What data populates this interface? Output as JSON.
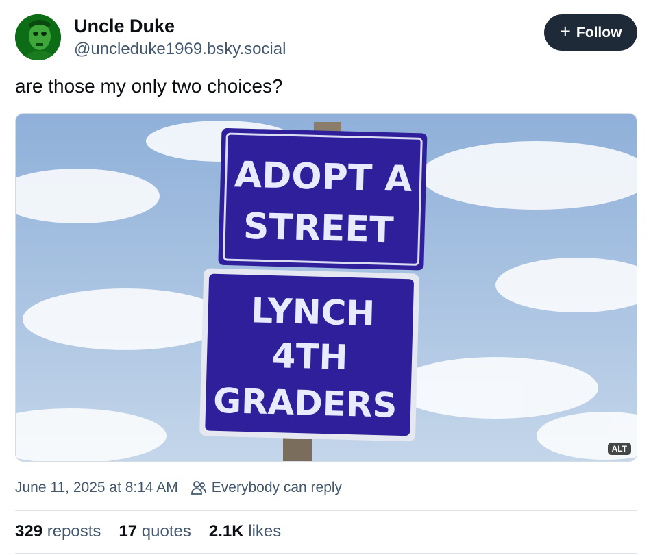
{
  "author": {
    "display_name": "Uncle Duke",
    "handle": "@uncleduke1969.bsky.social",
    "avatar_icon": "avatar-photo",
    "avatar_color": "#0d6d16"
  },
  "follow_button": {
    "label": "Follow",
    "icon": "plus-icon",
    "background": "#1e2a37"
  },
  "post": {
    "text": "are those my only two choices?",
    "image": {
      "sign_top_lines": [
        "ADOPT A",
        "STREET"
      ],
      "sign_bottom_lines": [
        "LYNCH",
        "4TH",
        "GRADERS"
      ],
      "sign_color": "#2f1f9a",
      "alt_badge": "ALT"
    }
  },
  "meta": {
    "timestamp": "June 11, 2025 at 8:14 AM",
    "reply_setting": "Everybody can reply",
    "reply_icon": "people-icon"
  },
  "stats": [
    {
      "count": "329",
      "label": "reposts"
    },
    {
      "count": "17",
      "label": "quotes"
    },
    {
      "count": "2.1K",
      "label": "likes"
    }
  ],
  "colors": {
    "text": "#0b0f14",
    "secondary": "#42576c",
    "divider": "#dfe4ea"
  }
}
